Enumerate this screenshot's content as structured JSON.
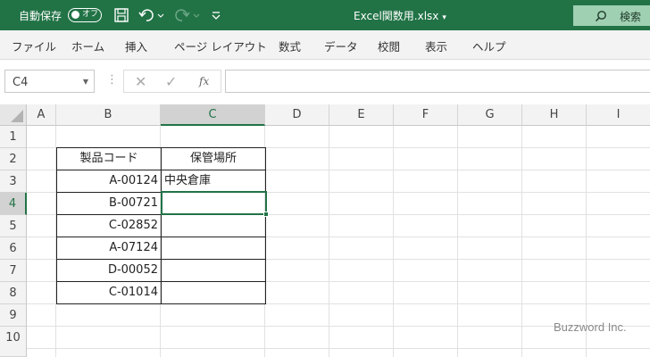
{
  "titlebar": {
    "autosave_label": "自動保存",
    "autosave_state": "オフ",
    "filename": "Excel関数用.xlsx",
    "search_label": "検索"
  },
  "ribbon": {
    "tabs": [
      "ファイル",
      "ホーム",
      "挿入",
      "ページ レイアウト",
      "数式",
      "データ",
      "校閲",
      "表示",
      "ヘルプ"
    ]
  },
  "formula_bar": {
    "name_box": "C4",
    "fx_label": "fx",
    "content": ""
  },
  "grid": {
    "columns": [
      "A",
      "B",
      "C",
      "D",
      "E",
      "F",
      "G",
      "H",
      "I"
    ],
    "rows": [
      "1",
      "2",
      "3",
      "4",
      "5",
      "6",
      "7",
      "8",
      "9",
      "10"
    ],
    "selected_column": "C",
    "selected_row": "4",
    "table": {
      "header_b": "製品コード",
      "header_c": "保管場所",
      "codes": [
        "A-00124",
        "B-00721",
        "C-02852",
        "A-07124",
        "D-00052",
        "C-01014"
      ],
      "locations": [
        "中央倉庫",
        "",
        "",
        "",
        "",
        ""
      ]
    }
  },
  "watermark": "Buzzword Inc.",
  "colors": {
    "accent": "#217346"
  }
}
